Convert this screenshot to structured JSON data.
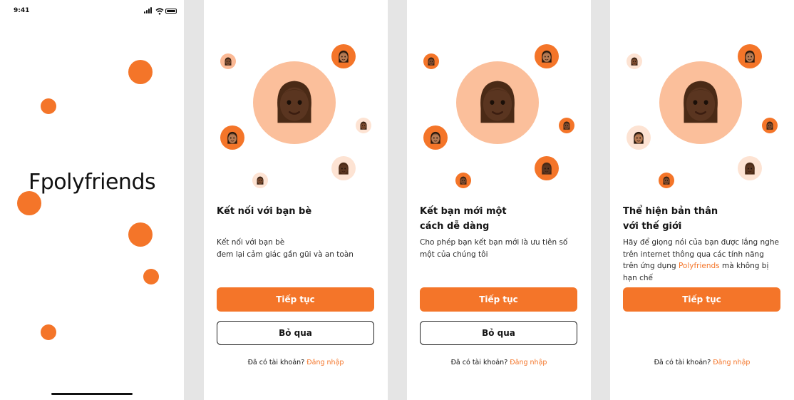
{
  "splash": {
    "status_time": "9:41",
    "brand": "Fpolyfriends"
  },
  "onboarding": [
    {
      "title_lines": [
        "Kết nối với bạn bè"
      ],
      "body": "Kết nối với bạn bè\nđem lại cảm giác gần gũi và an toàn",
      "continue_label": "Tiếp tục",
      "skip_label": "Bỏ qua",
      "login_prompt": "Đã có tài khoản?",
      "login_link": "Đăng nhập"
    },
    {
      "title_lines": [
        "Kết bạn mới một",
        "cách dễ dàng"
      ],
      "body": "Cho phép bạn kết bạn mới là ưu tiên số một của chúng tôi",
      "continue_label": "Tiếp tục",
      "skip_label": "Bỏ qua",
      "login_prompt": "Đã có tài khoản?",
      "login_link": "Đăng nhập"
    },
    {
      "title_lines": [
        "Thể hiện bản thân",
        "với thế giới"
      ],
      "body_prefix": "Hãy để giọng nói của bạn được lắng nghe trên internet thông qua các tính năng trên ứng dụng ",
      "body_highlight": "Polyfriends",
      "body_suffix": " mà không bị hạn chế",
      "continue_label": "Tiếp tục",
      "login_prompt": "Đã có tài khoản?",
      "login_link": "Đăng nhập"
    }
  ],
  "colors": {
    "accent": "#f47529",
    "peach": "#fbbf9b",
    "pale": "#fde3d3",
    "background": "#e5e5e5"
  },
  "icons": [
    "memoji-avatar-icon",
    "signal-icon",
    "wifi-icon",
    "battery-icon"
  ]
}
